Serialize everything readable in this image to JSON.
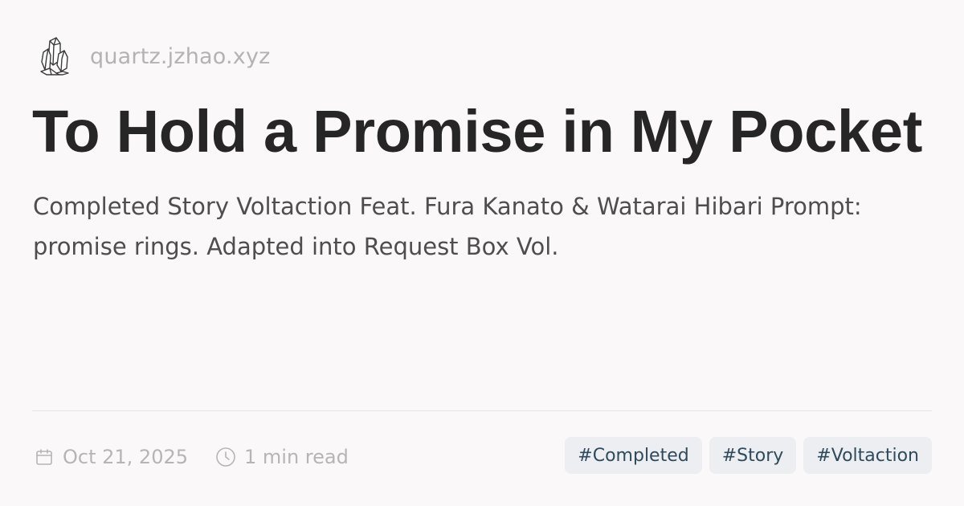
{
  "site": {
    "logo_icon": "crystal-logo-icon",
    "domain": "quartz.jzhao.xyz"
  },
  "article": {
    "title": "To Hold a Promise in My Pocket",
    "description": "Completed Story Voltaction Feat. Fura Kanato & Watarai Hibari Prompt: promise rings. Adapted into Request Box Vol."
  },
  "meta": {
    "date_icon": "calendar-icon",
    "date": "Oct 21, 2025",
    "reading_time_icon": "clock-icon",
    "reading_time": "1 min read"
  },
  "tags": [
    {
      "label": "#Completed"
    },
    {
      "label": "#Story"
    },
    {
      "label": "#Voltaction"
    }
  ],
  "colors": {
    "background": "#faf8f8",
    "title": "#262626",
    "muted": "#b5b5b5",
    "tag_bg": "#eceef1",
    "tag_text": "#2e4a5c"
  }
}
